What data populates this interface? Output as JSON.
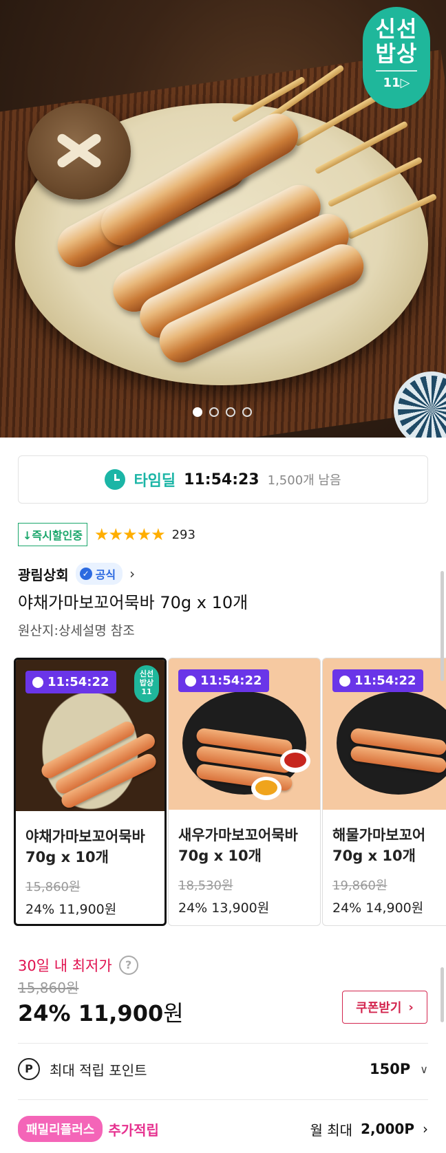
{
  "hero": {
    "badge_line1": "신선",
    "badge_line2": "밥상",
    "badge_logo": "11",
    "slide_count": 4,
    "active_slide": 1
  },
  "timedeal": {
    "icon": "alarm-clock-icon",
    "label": "타임딜",
    "time": "11:54:23",
    "remaining": "1,500개 남음",
    "accent_color": "#1bb5a6"
  },
  "rating": {
    "cert_label": "↓즉시할인중",
    "stars": "★★★★★",
    "score": 4.5,
    "review_count": "293"
  },
  "seller": {
    "name": "광림상회",
    "official_label": "공식",
    "chevron": "›"
  },
  "product": {
    "title": "야채가마보꼬어묵바 70g x 10개",
    "origin": "원산지:상세설명 참조"
  },
  "options": [
    {
      "timer": "11:54:22",
      "name_line1": "야채가마보꼬어묵바",
      "name_line2": "70g x 10개",
      "original_price": "15,860원",
      "price": "24% 11,900원",
      "selected": true
    },
    {
      "timer": "11:54:22",
      "name_line1": "새우가마보꼬어묵바",
      "name_line2": "70g x 10개",
      "original_price": "18,530원",
      "price": "24% 13,900원",
      "selected": false
    },
    {
      "timer": "11:54:22",
      "name_line1": "해물가마보꼬어",
      "name_line2": "70g x 10개",
      "original_price": "19,860원",
      "price": "24% 14,900원",
      "selected": false
    }
  ],
  "card_badge": "신선\n밥상\n11",
  "pricing": {
    "lowest_label": "30일 내 최저가",
    "help_icon": "?",
    "original": "15,860원",
    "discount_price": "24% 11,900",
    "won": "원",
    "coupon_label": "쿠폰받기",
    "coupon_chevron": "›",
    "accent_color": "#e0114f"
  },
  "points": {
    "icon_label": "P",
    "label": "최대 적립 포인트",
    "value": "150P",
    "caret": "∨"
  },
  "family": {
    "badge": "패밀리플러스",
    "extra": "추가적립",
    "monthly_prefix": "월 최대",
    "monthly_value": "2,000P",
    "chevron": "›"
  }
}
